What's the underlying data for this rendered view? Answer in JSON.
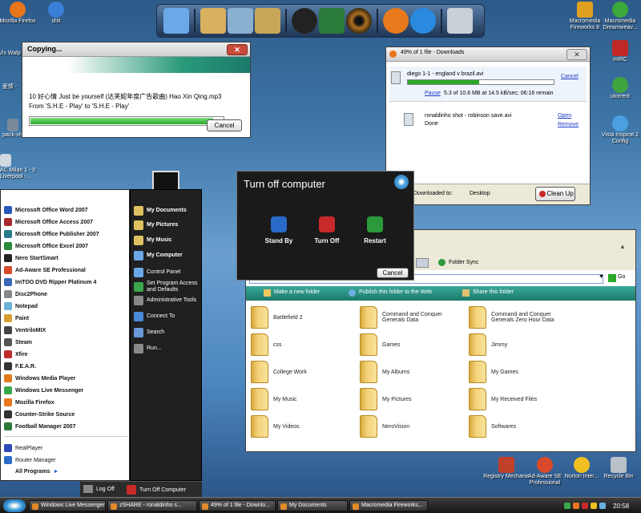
{
  "desktop_icons": [
    {
      "label": "Mozilla Firefox",
      "icon": "firefox-icon",
      "color": "#e8761c"
    },
    {
      "label": "shit",
      "icon": "ie-icon",
      "color": "#3a7ed8"
    },
    {
      "label": "Vis Walp",
      "icon": "folder-icon",
      "color": "#7aa0c8"
    },
    {
      "label": "爱情 -",
      "icon": "folder-icon",
      "color": "#6a8fb8"
    },
    {
      "label": "pack-vis",
      "icon": "document-icon",
      "color": "#7a8a9a"
    },
    {
      "label": "AC Milan 1 - 0 Liverpool -...",
      "icon": "video-file-icon",
      "color": "#d0d8e0"
    },
    {
      "label": "Macromedia Fireworks 8",
      "icon": "fireworks-icon",
      "color": "#e0a020"
    },
    {
      "label": "Macromedia Dreamweav...",
      "icon": "dreamweaver-icon",
      "color": "#3aa83a"
    },
    {
      "label": "mIRC",
      "icon": "mirc-icon",
      "color": "#c02828"
    },
    {
      "label": "utorrent",
      "icon": "utorrent-icon",
      "color": "#3fa43f"
    },
    {
      "label": "Vista Inspirat 2 Config",
      "icon": "windows-flag-icon",
      "color": "#4aa0e0"
    },
    {
      "label": "Registry Mechanic",
      "icon": "registry-icon",
      "color": "#c0402a"
    },
    {
      "label": "Ad-Aware SE Professional",
      "icon": "adaware-icon",
      "color": "#d84a2a"
    },
    {
      "label": "Norton Inter...",
      "icon": "norton-icon",
      "color": "#f0c020"
    },
    {
      "label": "Recycle Bin",
      "icon": "recycle-bin-icon",
      "color": "#b8c0c8"
    }
  ],
  "dock": {
    "items": [
      {
        "name": "my-computer-icon",
        "color": "#6aa8e8"
      },
      {
        "name": "folder-icon",
        "color": "#d8b060"
      },
      {
        "name": "folder-icon",
        "color": "#8ab0d0"
      },
      {
        "name": "folder-icon",
        "color": "#c8a858"
      },
      {
        "name": "counter-strike-icon",
        "color": "#222222"
      },
      {
        "name": "football-game-icon",
        "color": "#2a7a3a"
      },
      {
        "name": "eye-icon",
        "color": "#b07020"
      },
      {
        "name": "firefox-icon",
        "color": "#e87a1c"
      },
      {
        "name": "media-player-icon",
        "color": "#2a8ae0"
      },
      {
        "name": "recycle-bin-icon",
        "color": "#c8d0d8"
      }
    ]
  },
  "copying": {
    "title": "Copying...",
    "file_line": "10 好心情 Just be yourself (达芙妮年度广告歌曲) Hao Xin Qing.mp3",
    "from_line": "From 'S.H.E - Play' to 'S.H.E - Play'",
    "progress": 0.95,
    "cancel": "Cancel"
  },
  "downloads": {
    "title": "49% of 1 file - Downloads",
    "items": [
      {
        "name": "diego 1-1 - england v brazil.avi",
        "status": "5.3 of 10.6 MB at 14.5 kB/sec; 06:16 remain",
        "progress": 0.49,
        "actions": [
          "Pause",
          "Cancel"
        ]
      },
      {
        "name": "ronaldinho shot - robinson save.avi",
        "status": "Done",
        "progress": 1,
        "actions": [
          "Open",
          "Remove"
        ]
      }
    ],
    "downloaded_to_label": "Downloaded to:",
    "downloaded_to_value": "Desktop",
    "cleanup": "Clean Up"
  },
  "turnoff": {
    "title": "Turn off computer",
    "options": [
      {
        "label": "Stand By",
        "color": "#2a6ac8"
      },
      {
        "label": "Turn Off",
        "color": "#c82a2a"
      },
      {
        "label": "Restart",
        "color": "#2a9a3a"
      }
    ],
    "cancel": "Cancel"
  },
  "explorer": {
    "folder_sync": "Folder Sync",
    "address_value": "",
    "go": "Go",
    "tasks": [
      "Make a new folder",
      "Publish this folder to the Web",
      "Share this folder"
    ],
    "items": [
      "Battlefield 2",
      "Command and Conquer Generals Data",
      "Command and Conquer Generals Zero Hour Data",
      "css",
      "Games",
      "Jimmy",
      "College Work",
      "My Albums",
      "My Games",
      "My Music",
      "My Pictures",
      "My Received Files",
      "My Videos",
      "NeroVision",
      "Softwares"
    ]
  },
  "start_menu": {
    "programs": [
      {
        "label": "Microsoft Office Word 2007",
        "color": "#2a5ab8"
      },
      {
        "label": "Microsoft Office Access 2007",
        "color": "#a82a2a"
      },
      {
        "label": "Microsoft Office Publisher 2007",
        "color": "#2a7a8a"
      },
      {
        "label": "Microsoft Office Excel 2007",
        "color": "#2a8a3a"
      },
      {
        "label": "Nero StartSmart",
        "color": "#222222"
      },
      {
        "label": "Ad-Aware SE Professional",
        "color": "#d84a2a"
      },
      {
        "label": "ImTOO DVD Ripper Platinum 4",
        "color": "#3a6ab8"
      },
      {
        "label": "Disc2Phone",
        "color": "#888888"
      },
      {
        "label": "Notepad",
        "color": "#6ab0d8"
      },
      {
        "label": "Paint",
        "color": "#d8a030"
      },
      {
        "label": "VentriloMIX",
        "color": "#444444"
      },
      {
        "label": "Steam",
        "color": "#555555"
      },
      {
        "label": "Xfire",
        "color": "#c02a2a"
      },
      {
        "label": "F.E.A.R.",
        "color": "#333333"
      },
      {
        "label": "Windows Media Player",
        "color": "#e07a1a"
      },
      {
        "label": "Windows Live Messenger",
        "color": "#3aa84a"
      },
      {
        "label": "Mozilla Firefox",
        "color": "#e8761c"
      },
      {
        "label": "Counter-Strike Source",
        "color": "#333333"
      },
      {
        "label": "Football Manager 2007",
        "color": "#2a7a3a"
      }
    ],
    "recent": [
      {
        "label": "RealPlayer",
        "color": "#2a4ab8"
      },
      {
        "label": "Router Manager",
        "color": "#2a6ac8"
      }
    ],
    "all_programs": "All Programs",
    "right": [
      {
        "label": "My Documents",
        "bold": true,
        "color": "#e0c060"
      },
      {
        "label": "My Pictures",
        "bold": true,
        "color": "#e0c060"
      },
      {
        "label": "My Music",
        "bold": true,
        "color": "#e0c060"
      },
      {
        "label": "My Computer",
        "bold": true,
        "color": "#6aa8e8"
      },
      {
        "label": "Control Panel",
        "bold": false,
        "color": "#6aa8e8"
      },
      {
        "label": "Set Program Access and Defaults",
        "bold": false,
        "color": "#3aa84a"
      },
      {
        "label": "Administrative Tools",
        "bold": false,
        "color": "#8a8a8a"
      },
      {
        "label": "Connect To",
        "bold": false,
        "color": "#4a8ad8"
      },
      {
        "label": "Search",
        "bold": false,
        "color": "#6a9ad8"
      },
      {
        "label": "Run...",
        "bold": false,
        "color": "#8a8a8a"
      }
    ],
    "logoff": "Log Off",
    "turnoff": "Turn Off Computer"
  },
  "taskbar": {
    "tasks": [
      "Windows Live Messenger",
      "zSHARE - ronaldinho s...",
      "49% of 1 file - Downlo...",
      "My Documents",
      "Macromedia Fireworks..."
    ],
    "time": "20:58"
  }
}
